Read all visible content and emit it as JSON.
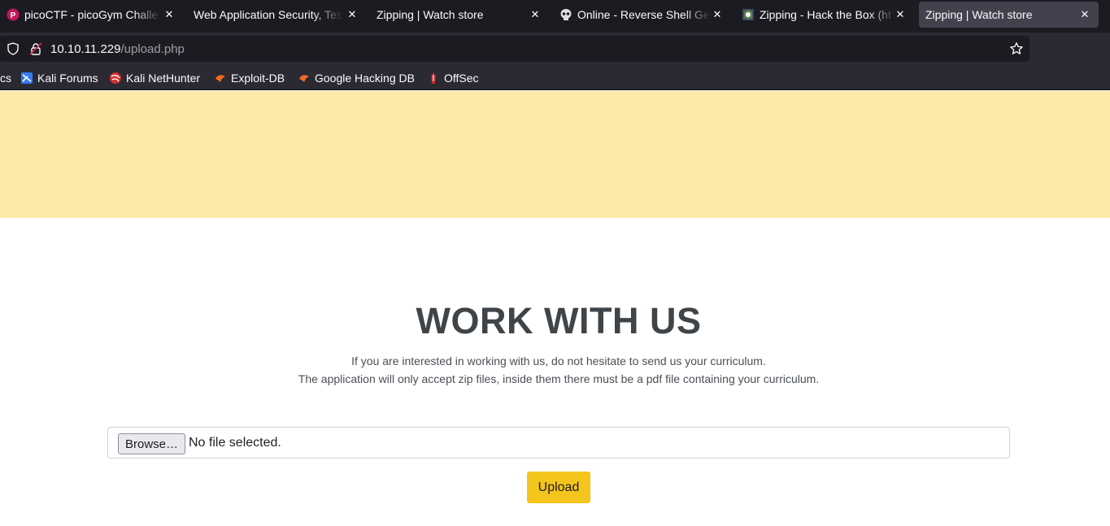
{
  "tabs": [
    {
      "title": "picoCTF - picoGym Challe",
      "icon": "picoctf-icon",
      "closable": true
    },
    {
      "title": "Web Application Security, Tes",
      "icon": "",
      "closable": true
    },
    {
      "title": "Zipping | Watch store",
      "icon": "",
      "closable": true
    },
    {
      "title": "Online - Reverse Shell Ge",
      "icon": "skull-icon",
      "closable": true
    },
    {
      "title": "Zipping - Hack the Box (ht",
      "icon": "htb-icon",
      "closable": true
    },
    {
      "title": "Zipping | Watch store",
      "icon": "",
      "closable": true,
      "active": true
    }
  ],
  "url": {
    "host": "10.10.11.229",
    "path": "/upload.php"
  },
  "bookmarks": [
    {
      "label": "cs",
      "icon": ""
    },
    {
      "label": "Kali Forums",
      "icon": "kali-forums-icon"
    },
    {
      "label": "Kali NetHunter",
      "icon": "kali-nethunter-icon"
    },
    {
      "label": "Exploit-DB",
      "icon": "exploit-db-icon"
    },
    {
      "label": "Google Hacking DB",
      "icon": "ghdb-icon"
    },
    {
      "label": "OffSec",
      "icon": "offsec-icon"
    }
  ],
  "main": {
    "title": "WORK WITH US",
    "description_line1": "If you are interested in working with us, do not hesitate to send us your curriculum.",
    "description_line2": "The application will only accept zip files, inside them there must be a pdf file containing your curriculum.",
    "browse_label": "Browse…",
    "file_status": "No file selected.",
    "upload_label": "Upload"
  },
  "colors": {
    "banner": "#fce9a8",
    "upload_button": "#f4c51c",
    "tabbar": "#1c1b22",
    "toolbar": "#2b2a33"
  }
}
